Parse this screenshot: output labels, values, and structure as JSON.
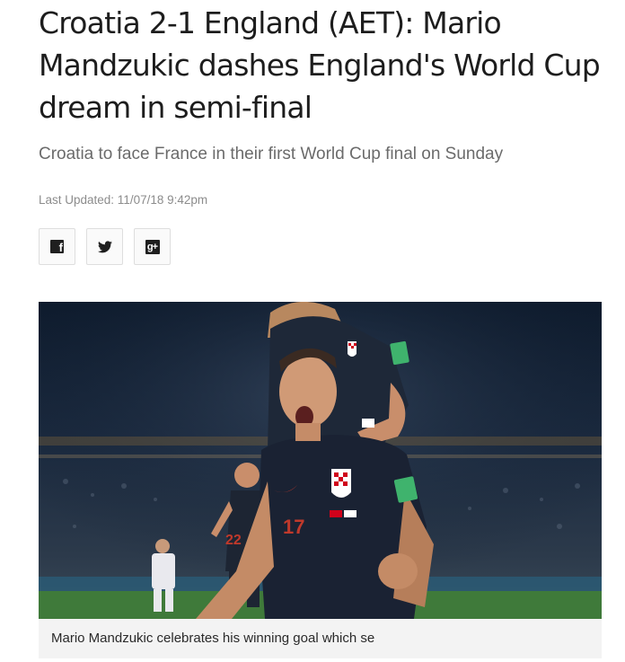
{
  "article": {
    "headline": "Croatia 2-1 England (AET): Mario Mandzukic dashes England's World Cup dream in semi-final",
    "standfirst": "Croatia to face France in their first World Cup final on Sunday",
    "last_updated": "Last Updated: 11/07/18 9:42pm"
  },
  "share": {
    "facebook_icon": "facebook-icon",
    "twitter_icon": "twitter-icon",
    "googleplus_icon": "google-plus-icon"
  },
  "image": {
    "caption": "Mario Mandzukic celebrates his winning goal which se",
    "shirt_number_main": "17",
    "shirt_number_background": "22"
  },
  "colors": {
    "headline": "#1d1d1d",
    "standfirst": "#6b6b6b",
    "meta": "#8c8c8c",
    "caption_bg": "#f3f3f3"
  }
}
